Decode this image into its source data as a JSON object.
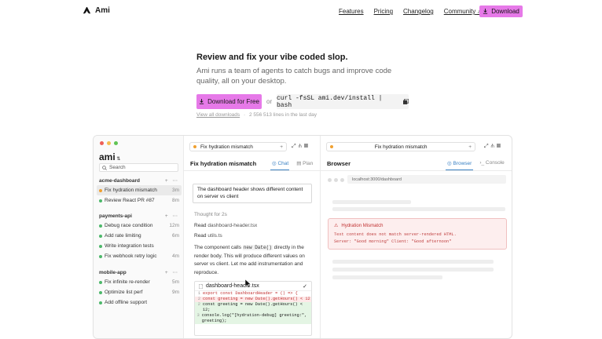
{
  "nav": {
    "brand": "Ami",
    "links": [
      "Features",
      "Pricing",
      "Changelog",
      "Community"
    ],
    "download": "Download"
  },
  "hero": {
    "title": "Review and fix your vibe coded slop.",
    "subtitle": "Ami runs a team of agents to catch bugs and improve code quality, all on your desktop.",
    "cta": "Download for Free",
    "or": "or",
    "command": "curl -fsSL ami.dev/install | bash",
    "all_downloads": "View all downloads",
    "sep": "·",
    "count": "2 556 513",
    "count_suffix": " lines in the last day"
  },
  "app": {
    "title": "ami",
    "search_placeholder": "Search",
    "projects": [
      {
        "name": "acme-dashboard",
        "tasks": [
          {
            "label": "Fix hydration mismatch",
            "time": "3m",
            "color": "#f0a030",
            "selected": true
          },
          {
            "label": "Review React PR #87",
            "time": "8m",
            "color": "#4cb86a",
            "selected": false
          }
        ]
      },
      {
        "name": "payments-api",
        "tasks": [
          {
            "label": "Debug race condition",
            "time": "12m",
            "color": "#4cb86a",
            "selected": false
          },
          {
            "label": "Add rate limiting",
            "time": "6m",
            "color": "#4cb86a",
            "selected": false
          },
          {
            "label": "Write integration tests",
            "time": "",
            "color": "#4cb86a",
            "selected": false
          },
          {
            "label": "Fix webhook retry logic",
            "time": "4m",
            "color": "#4cb86a",
            "selected": false
          }
        ]
      },
      {
        "name": "mobile-app",
        "tasks": [
          {
            "label": "Fix infinite re-render",
            "time": "5m",
            "color": "#4cb86a",
            "selected": false
          },
          {
            "label": "Optimize list perf",
            "time": "9m",
            "color": "#4cb86a",
            "selected": false
          },
          {
            "label": "Add offline support",
            "time": "",
            "color": "#4cb86a",
            "selected": false
          }
        ]
      }
    ],
    "chat": {
      "tab_label": "Fix hydration mismatch",
      "panel_title": "Fix hydration mismatch",
      "tab_chat": "Chat",
      "tab_plan": "Plan",
      "user_message": "The dashboard header shows different content on server vs client",
      "thought": "Thought for 2s",
      "read_word": "Read",
      "read_files": [
        "dashboard-header.tsx",
        "utils.ts"
      ],
      "para_1": "The component calls ",
      "para_code": "new Date()",
      "para_2": " directly in the render body. This will produce different values on server vs client. Let me add instrumentation and reproduce.",
      "diff_file": "dashboard-header.tsx",
      "diff_lines": [
        {
          "n": "1",
          "kind": "ctx",
          "text": "export const DashboardHeader = () => {"
        },
        {
          "n": "2",
          "kind": "del",
          "text": "  const greeting = new Date().getHours() < 12"
        },
        {
          "n": "2",
          "kind": "add",
          "text": "  const greeting = new Date().getHours() < 12;"
        },
        {
          "n": "3",
          "kind": "add",
          "text": "  console.log(\"[hydration-debug] greeting:\", greeting);"
        }
      ]
    },
    "browser": {
      "tab_label": "Fix hydration mismatch",
      "panel_title": "Browser",
      "tab_browser": "Browser",
      "tab_console": "Console",
      "url": "localhost:3000/dashboard",
      "error_title": "Hydration Mismatch",
      "error_line1": "Text content does not match server-rendered HTML.",
      "error_line2": "Server: \"Good morning\" Client: \"Good afternoon\""
    }
  }
}
